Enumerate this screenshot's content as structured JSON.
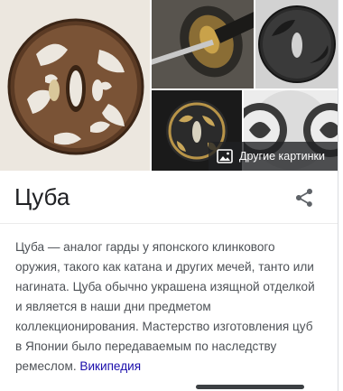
{
  "images": {
    "tiles": [
      {
        "name": "tsuba-openwork-dragon",
        "alt": "tsuba image 1"
      },
      {
        "name": "tsuba-on-katana",
        "alt": "tsuba image 2"
      },
      {
        "name": "tsuba-dark-iron",
        "alt": "tsuba image 3"
      },
      {
        "name": "tsuba-gold-inlay",
        "alt": "tsuba image 4"
      },
      {
        "name": "tsuba-white-pattern",
        "alt": "tsuba image 5"
      }
    ],
    "more_label": "Другие картинки",
    "more_icon": "image-gallery-icon"
  },
  "title": "Цуба",
  "share_icon": "share-icon",
  "description": {
    "text": "Цуба — аналог гарды у японского клинкового оружия, такого как катана и других мечей, танто или нагината. Цуба обычно украшена изящной отделкой и является в наши дни предметом коллекционирования. Мастерство изготовления цуб в Японии было передаваемым по наследству ремеслом.",
    "source_link": "Википедия"
  },
  "colors": {
    "link": "#1a0dab",
    "text": "#4d5156",
    "title": "#202124"
  }
}
